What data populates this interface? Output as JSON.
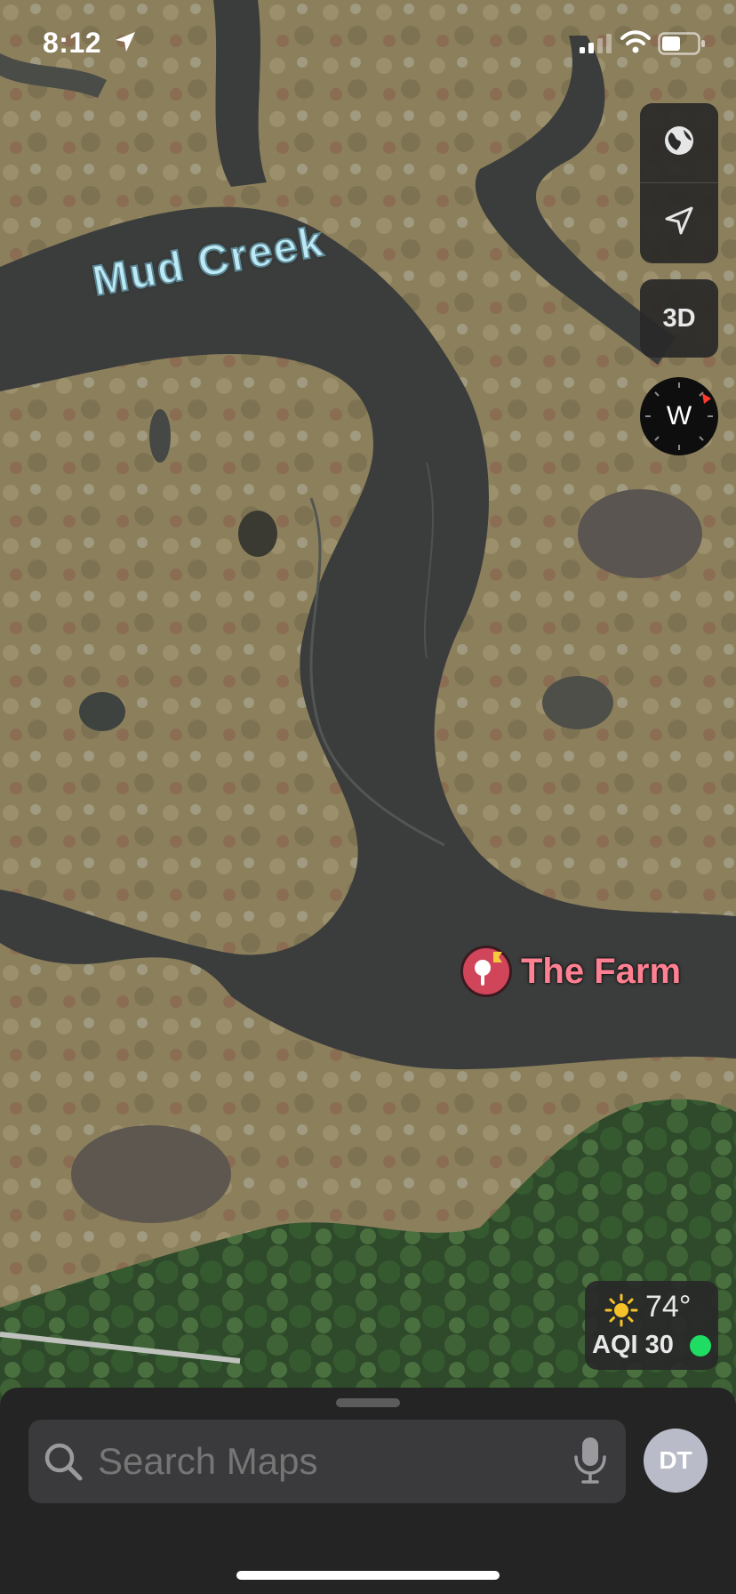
{
  "status_bar": {
    "time": "8:12"
  },
  "map": {
    "labels": {
      "creek": "Mud Creek",
      "place": "The Farm"
    }
  },
  "controls": {
    "three_d": "3D",
    "compass_heading": "W"
  },
  "weather": {
    "temperature": "74°",
    "aqi": "AQI 30",
    "aqi_color": "#1fdc62"
  },
  "search": {
    "placeholder": "Search Maps"
  },
  "account": {
    "initials": "DT"
  },
  "icons": [
    "location-arrow-icon",
    "signal-icon",
    "wifi-icon",
    "battery-icon",
    "globe-icon",
    "navigation-arrow-icon",
    "compass-icon",
    "pin-icon",
    "sun-icon",
    "search-icon",
    "microphone-icon"
  ]
}
